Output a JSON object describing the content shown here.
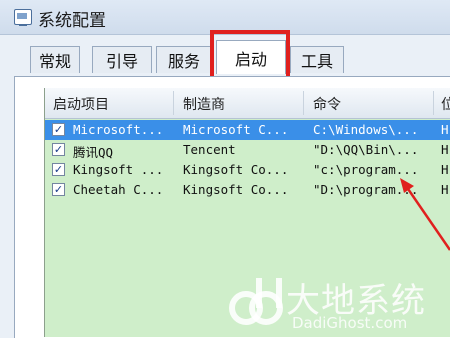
{
  "window": {
    "title": "系统配置"
  },
  "tabs": [
    {
      "label": "常规"
    },
    {
      "label": "引导"
    },
    {
      "label": "服务"
    },
    {
      "label": "启动",
      "active": true
    },
    {
      "label": "工具"
    }
  ],
  "startup_table": {
    "columns": [
      "启动项目",
      "制造商",
      "命令",
      "位"
    ],
    "rows": [
      {
        "checked": true,
        "item": "Microsoft...",
        "maker": "Microsoft C...",
        "command": "C:\\Windows\\...",
        "loc": "H",
        "selected": true
      },
      {
        "checked": true,
        "item": "腾讯QQ",
        "maker": "Tencent",
        "command": "\"D:\\QQ\\Bin\\...",
        "loc": "H"
      },
      {
        "checked": true,
        "item": "Kingsoft ...",
        "maker": "Kingsoft Co...",
        "command": "\"c:\\program...",
        "loc": "H"
      },
      {
        "checked": true,
        "item": "Cheetah C...",
        "maker": "Kingsoft Co...",
        "command": "\"D:\\program...",
        "loc": "H"
      }
    ]
  },
  "watermark": {
    "brand": "大地系统",
    "url": "DadiGhost.com"
  },
  "colors": {
    "highlight": "#e0201e",
    "list_background": "#cfeeca",
    "selection": "#3a8fe8"
  }
}
